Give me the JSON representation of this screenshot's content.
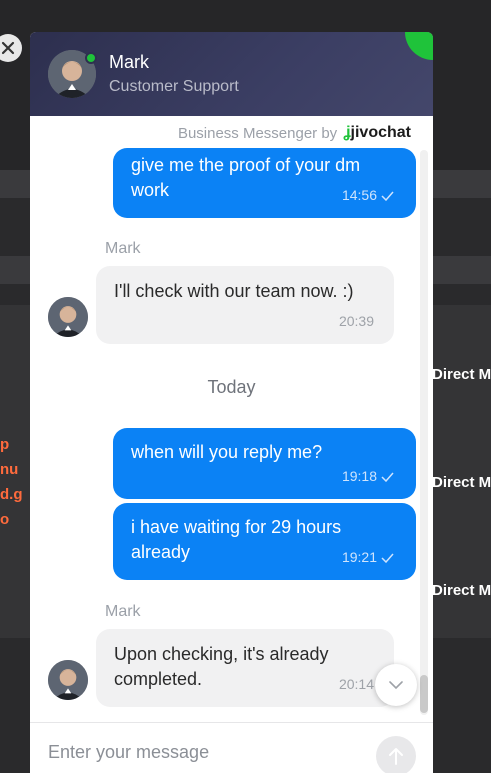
{
  "background": {
    "side_labels": [
      "Direct M",
      "Direct M",
      "Direct M"
    ],
    "orange_fragments": [
      "p",
      "nu",
      "d.g",
      "o"
    ]
  },
  "widget": {
    "agent_name": "Mark",
    "agent_role": "Customer Support",
    "online": true,
    "branding_text": "Business Messenger by",
    "brand_logo": "jivochat",
    "messages": [
      {
        "direction": "out",
        "text": "give me the proof of your dm work",
        "time": "14:56",
        "status": "sent"
      },
      {
        "direction": "in",
        "sender": "Mark",
        "text": "I'll check with our team now. :)",
        "time": "20:39"
      },
      {
        "direction": "out",
        "text": "when will you reply me?",
        "time": "19:18",
        "status": "sent"
      },
      {
        "direction": "out",
        "text": "i have waiting for 29 hours already",
        "time": "19:21",
        "status": "sent"
      },
      {
        "direction": "in",
        "sender": "Mark",
        "text": "Upon checking, it's already completed.",
        "time": "20:14"
      }
    ],
    "date_separator": "Today",
    "input_placeholder": "Enter your message"
  },
  "colors": {
    "accent": "#0b82f5",
    "online": "#1fc33a",
    "header": "#2d2f4e"
  },
  "icons": [
    "close-icon",
    "checkmark-icon",
    "chevron-down-icon",
    "send-arrow-icon"
  ]
}
